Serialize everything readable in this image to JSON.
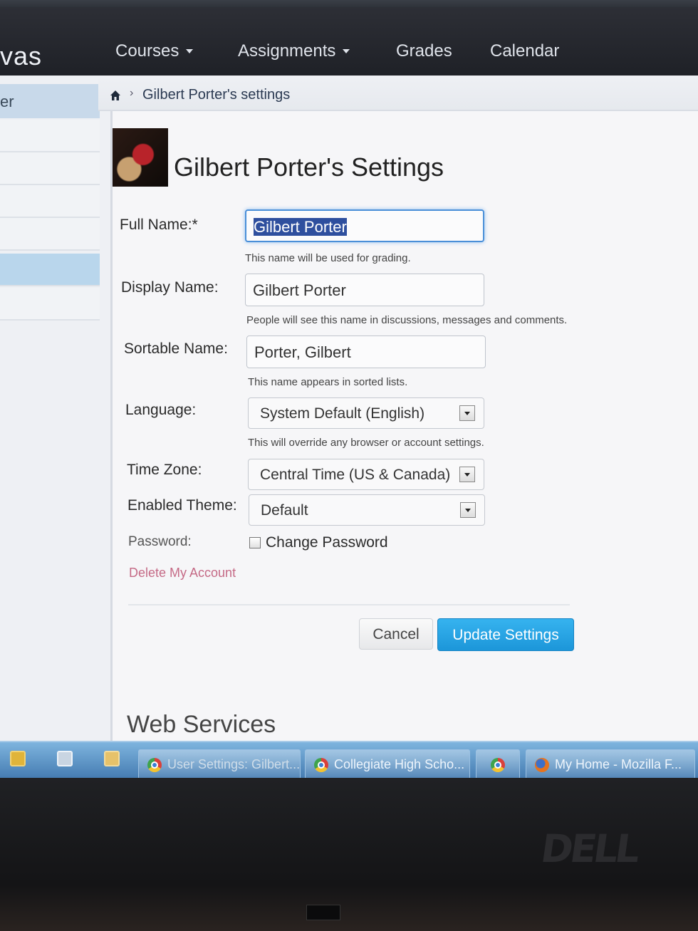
{
  "app": {
    "logo_text": "vas"
  },
  "nav": {
    "items": [
      {
        "label": "Courses",
        "has_caret": true
      },
      {
        "label": "Assignments",
        "has_caret": true
      },
      {
        "label": "Grades",
        "has_caret": false
      },
      {
        "label": "Calendar",
        "has_caret": false
      }
    ]
  },
  "sidebar": {
    "header_label": "er"
  },
  "breadcrumb": {
    "current": "Gilbert Porter's settings"
  },
  "page": {
    "title": "Gilbert Porter's Settings"
  },
  "form": {
    "full_name": {
      "label": "Full Name:*",
      "value": "Gilbert Porter",
      "hint": "This name will be used for grading."
    },
    "display_name": {
      "label": "Display Name:",
      "value": "Gilbert Porter",
      "hint": "People will see this name in discussions, messages and comments."
    },
    "sortable_name": {
      "label": "Sortable Name:",
      "value": "Porter, Gilbert",
      "hint": "This name appears in sorted lists."
    },
    "language": {
      "label": "Language:",
      "value": "System Default (English)",
      "hint": "This will override any browser or account settings."
    },
    "time_zone": {
      "label": "Time Zone:",
      "value": "Central Time (US & Canada)"
    },
    "theme": {
      "label": "Enabled Theme:",
      "value": "Default"
    },
    "password": {
      "label": "Password:",
      "checkbox_label": "Change Password",
      "checked": false
    },
    "delete_link": "Delete My Account",
    "cancel_label": "Cancel",
    "update_label": "Update Settings"
  },
  "section": {
    "web_services_title": "Web Services"
  },
  "taskbar": {
    "items": [
      {
        "label": "User Settings: Gilbert...",
        "icon": "chrome-icon"
      },
      {
        "label": "Collegiate High Scho...",
        "icon": "chrome-icon"
      },
      {
        "label": "",
        "icon": "chrome-icon"
      },
      {
        "label": "My Home - Mozilla F...",
        "icon": "firefox-icon"
      }
    ]
  },
  "hardware": {
    "brand": "DELL"
  }
}
